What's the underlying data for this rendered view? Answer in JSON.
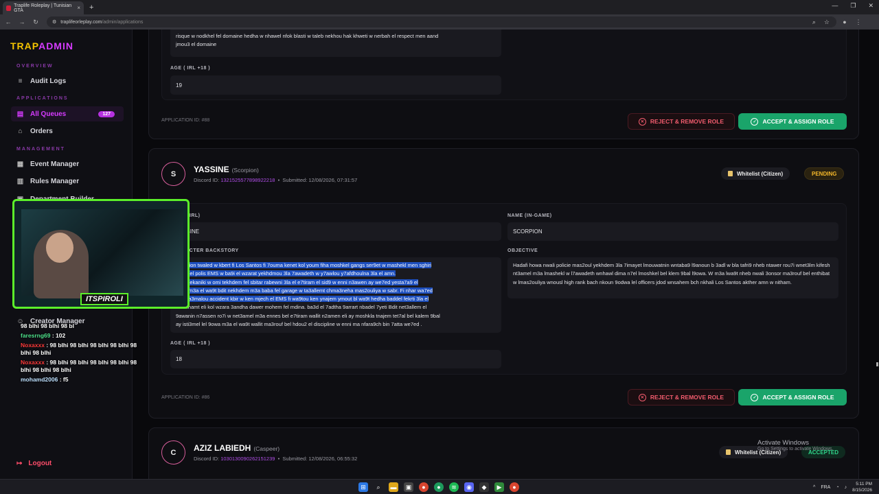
{
  "browser": {
    "tab_title": "Traplife Roleplay | Tunisian GTA",
    "tab_close": "×",
    "new_tab": "+",
    "url_domain": "traplifeorleplay.com",
    "url_path": "/admin/applications"
  },
  "sidebar": {
    "logo_a": "TRAP",
    "logo_b": "ADMIN",
    "sections": [
      "OVERVIEW",
      "APPLICATIONS",
      "MANAGEMENT"
    ],
    "items": [
      {
        "label": "Audit Logs",
        "icon": "list-icon"
      },
      {
        "label": "All Queues",
        "icon": "queue-icon",
        "badge": "127"
      },
      {
        "label": "Orders",
        "icon": "cart-icon"
      },
      {
        "label": "Event Manager",
        "icon": "calendar-icon"
      },
      {
        "label": "Rules Manager",
        "icon": "book-icon"
      },
      {
        "label": "Department Builder",
        "icon": "building-icon"
      },
      {
        "label": "Creator Manager",
        "icon": "user-icon"
      }
    ],
    "logout": "Logout"
  },
  "app_prev": {
    "text_top": "risque w nodkhel fel domaine hedha w nhawel nfok blasti w taleb nekhou hak khweti w nerbah el respect men aand",
    "text_bottom": "jmou3 el domaine",
    "age_label": "AGE ( IRL +18 )",
    "age": "19",
    "app_id": "APPLICATION ID: #88",
    "reject": "REJECT & REMOVE ROLE",
    "accept": "ACCEPT & ASSIGN ROLE"
  },
  "app_main": {
    "initial": "S",
    "name": "YASSINE",
    "nick": "(Scorpion)",
    "discord_label": "Discord ID:",
    "discord_id": "1321525577898922218",
    "submitted": "Submitted: 12/08/2026, 07:31:57",
    "type": "Whitelist (Citizen)",
    "status": "PENDING",
    "name_irl_label": "NAME (IRL)",
    "name_irl": "YASSINE",
    "name_game_label": "NAME (IN-GAME)",
    "name_game": "SCORPION",
    "backstory_label": "CHARACTER BACKSTORY",
    "backstory_lines": [
      "Scorpion twaled w kbert fi Los Santos fi 7ouma kenet kol youm fiha moshkel gangs ser9et w mashekl men sghiri",
      "chouf el polis EMS w ba9i el wzarat yekhdmou 3la 7awadeth w y7awlou y7afdhoulna 3la el amn.",
      "ken mekaniki w omi tekhdem fel sbitar rabewni 3la el e7tiram el sid9 w enni n3awen ay we7ed yesta7a9 el",
      "a3da m3a el wa9t bdit nekhdem m3a baba fel garage w ta3allemt chma3neha mas2ouliya w sabr. Fi nhar wa7ed",
      "7abi ta3malou accident kbir w ken mjech el EMS fi wa9tou ken ynajem ymout bl wa9t hedha baddel fekrti 3la el",
      "et w fhamt eli kol wzara 3andha dawer mohem fel mdina. ba3d el 7adtha 9arrart nbadel 7yeti Bdit net3allem el",
      "9awanin n7assen ro7i w net3amel m3a ennes bel e7tiram wallit n2amen eli ay moshkla tnajem tet7al bel kalem 9bal",
      "ay isti3mel lel 9owa m3a el wa9t wallit ma3rouf bel hdou2 el discipline w enni ma nfara9ch bin 7atta we7ed ."
    ],
    "objective_label": "OBJECTIVE",
    "objective": "Hadafi howa nwali policie mas2oul yekhdem 3la 7imayet lmouwatnin wntaba9 l9anoun b 3adl w bla tafri9 nheb ntawer rou7i wnet3lm kifesh nt3amel m3a lmashekl w l7awadeth wnhawl dima n7el lmoshkel bel klem 9bal l9owa. W m3a lwa9t nheb nwali 3onsor ma3rouf bel enthibat w lmas2ouliya wnousl high rank bach nkoun 9odwa lel officers jdod wnsahem bch nkhali  Los Santos akther amn w nitham.",
    "age_label": "AGE ( IRL +18 )",
    "age": "18",
    "app_id": "APPLICATION ID: #86",
    "reject": "REJECT & REMOVE ROLE",
    "accept": "ACCEPT & ASSIGN ROLE"
  },
  "app_next": {
    "initial": "C",
    "name": "AZIZ LABIEDH",
    "nick": "(Caspeer)",
    "discord_label": "Discord ID:",
    "discord_id": "1030130090262151239",
    "submitted": "Submitted: 12/08/2026, 06:55:32",
    "type": "Whitelist (Citizen)",
    "status": "ACCEPTED"
  },
  "overlay": {
    "streamer": "ITSPIROLI",
    "chat": [
      {
        "user": "",
        "msg": "98 blhi 98 blhi 98 bl"
      },
      {
        "user": "faresrng69",
        "msg": " : 102"
      },
      {
        "user": "Noxaxxx",
        "msg": " : 98 blhi 98 blhi 98 blhi 98 blhi 98 blhi 98 blhi"
      },
      {
        "user": "Noxaxxx",
        "msg": " : 98 blhi 98 blhi 98 blhi 98 blhi 98 blhi 98 blhi 98 blhi"
      },
      {
        "user": "mohamd2006",
        "msg": " : f5"
      }
    ]
  },
  "watermark": {
    "title": "Activate Windows",
    "sub": "Go to Settings to activate Windows."
  },
  "taskbar": {
    "lang": "FRA",
    "time": "5:11 PM",
    "date": "8/15/2026"
  },
  "colors": {
    "accent": "#d63bff",
    "logo": "#f5c400",
    "accept": "#1aa46a",
    "reject": "#f25c6e"
  }
}
